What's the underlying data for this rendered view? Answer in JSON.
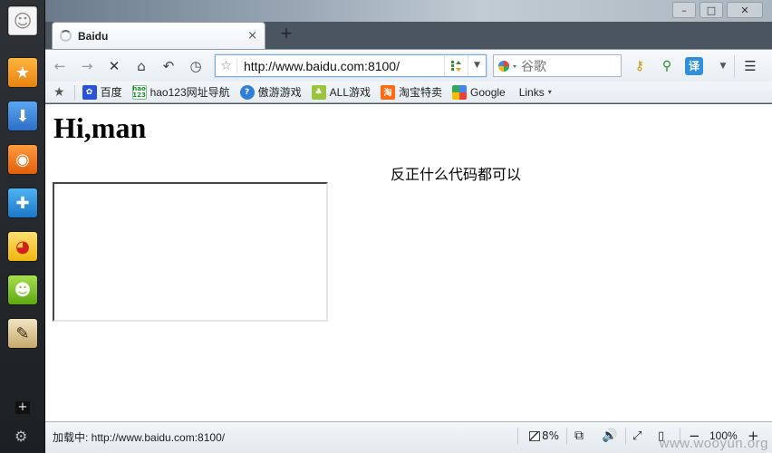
{
  "browser": {
    "tab": {
      "title": "Baidu",
      "close_glyph": "×"
    },
    "new_tab_glyph": "+",
    "window_controls": {
      "minimize": "–",
      "maximize": "□",
      "close": "✕"
    },
    "nav": {
      "back": "←",
      "forward": "→",
      "stop": "✕",
      "home": "⌂",
      "undo": "↶",
      "history": "◷"
    },
    "url": {
      "star": "☆",
      "value": "http://www.baidu.com:8100/",
      "dropdown": "▼"
    },
    "search": {
      "placeholder": "谷歌",
      "engine": "google"
    },
    "tools": {
      "key": "⚷",
      "mag": "⚲",
      "trans": "译",
      "drop": "▼",
      "menu": "☰"
    }
  },
  "bookmarks": {
    "star": "★",
    "items": [
      {
        "label": "百度",
        "icon": "baidu-icon"
      },
      {
        "label": "hao123网址导航",
        "icon": "hao123-icon"
      },
      {
        "label": "傲游游戏",
        "icon": "aoyou-icon"
      },
      {
        "label": "ALL游戏",
        "icon": "allgame-icon"
      },
      {
        "label": "淘宝特卖",
        "icon": "taobao-icon"
      },
      {
        "label": "Google",
        "icon": "google-icon"
      }
    ],
    "links_label": "Links",
    "links_caret": "▾"
  },
  "page": {
    "heading": "Hi,man",
    "text": "反正什么代码都可以"
  },
  "status": {
    "text": "加载中: http://www.baidu.com:8100/",
    "cpu": "8%",
    "zoom": "100%",
    "minus": "−",
    "plus": "+",
    "sound": "🔊",
    "screen": "⧉",
    "full": "⤢",
    "read": "▯"
  },
  "dock": {
    "face": "☺",
    "fav": "★",
    "download": "⬇",
    "rss": "◉",
    "game": "✚",
    "weibo": "◕",
    "smile": "☻",
    "note": "✎",
    "add": "+",
    "gear": "⚙"
  },
  "watermark": "www.wooyun.org"
}
